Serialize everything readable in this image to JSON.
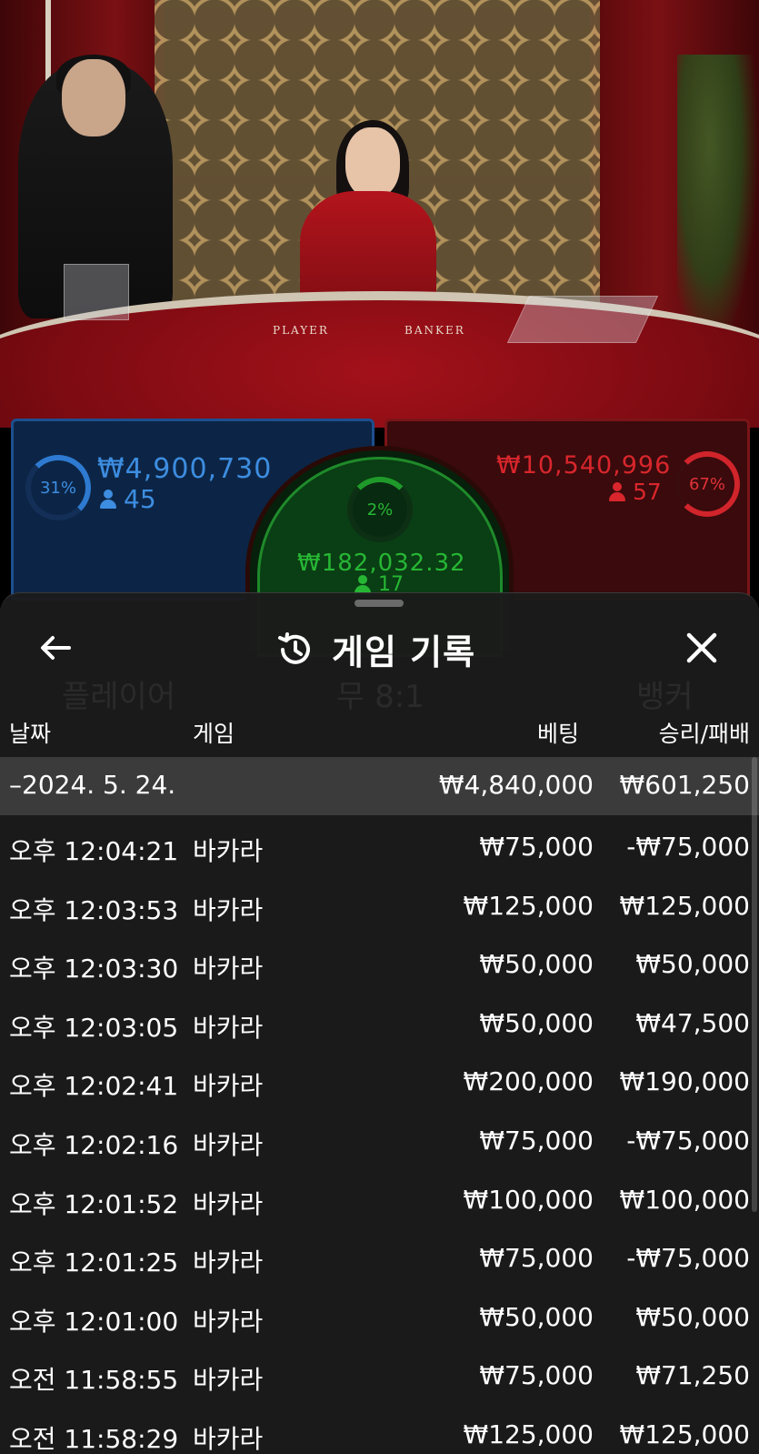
{
  "video": {
    "table_labels": {
      "player": "PLAYER",
      "banker": "BANKER"
    }
  },
  "bets": {
    "player": {
      "percent": "31%",
      "amount": "₩4,900,730",
      "players": "45",
      "color": "#3d8de0"
    },
    "tie": {
      "percent": "2%",
      "amount": "₩182,032.32",
      "players": "17",
      "color": "#27b634"
    },
    "banker": {
      "percent": "67%",
      "amount": "₩10,540,996",
      "players": "57",
      "color": "#d8262c"
    }
  },
  "background_board": {
    "labels": [
      "플레이어",
      "무 8:1",
      "뱅커"
    ]
  },
  "history": {
    "title": "게임 기록",
    "icons": {
      "back": "arrow-left-icon",
      "history": "history-clock-icon",
      "close": "close-icon"
    },
    "columns": {
      "date": "날짜",
      "game": "게임",
      "bet": "베팅",
      "result": "승리/패배"
    },
    "summary": {
      "date": "–2024. 5. 24.",
      "bet": "₩4,840,000",
      "result": "₩601,250"
    },
    "rows": [
      {
        "time": "오후 12:04:21",
        "game": "바카라",
        "bet": "₩75,000",
        "result": "-₩75,000"
      },
      {
        "time": "오후 12:03:53",
        "game": "바카라",
        "bet": "₩125,000",
        "result": "₩125,000"
      },
      {
        "time": "오후 12:03:30",
        "game": "바카라",
        "bet": "₩50,000",
        "result": "₩50,000"
      },
      {
        "time": "오후 12:03:05",
        "game": "바카라",
        "bet": "₩50,000",
        "result": "₩47,500"
      },
      {
        "time": "오후 12:02:41",
        "game": "바카라",
        "bet": "₩200,000",
        "result": "₩190,000"
      },
      {
        "time": "오후 12:02:16",
        "game": "바카라",
        "bet": "₩75,000",
        "result": "-₩75,000"
      },
      {
        "time": "오후 12:01:52",
        "game": "바카라",
        "bet": "₩100,000",
        "result": "₩100,000"
      },
      {
        "time": "오후 12:01:25",
        "game": "바카라",
        "bet": "₩75,000",
        "result": "-₩75,000"
      },
      {
        "time": "오후 12:01:00",
        "game": "바카라",
        "bet": "₩50,000",
        "result": "₩50,000"
      },
      {
        "time": "오전 11:58:55",
        "game": "바카라",
        "bet": "₩75,000",
        "result": "₩71,250"
      },
      {
        "time": "오전 11:58:29",
        "game": "바카라",
        "bet": "₩125,000",
        "result": "₩125,000"
      }
    ]
  }
}
